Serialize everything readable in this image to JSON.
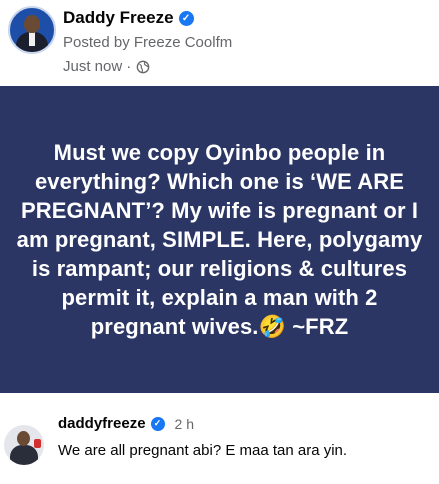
{
  "post": {
    "author_name": "Daddy Freeze",
    "posted_by": "Posted by Freeze Coolfm",
    "time": "Just now",
    "separator": "·",
    "privacy_icon": "globe-icon"
  },
  "banner": {
    "text": "Must we copy Oyinbo people in everything? Which one is ‘WE ARE PREGNANT’? My wife is pregnant or I am pregnant, SIMPLE. Here, polygamy is rampant; our religions & cultures permit it, explain a man with 2 pregnant wives.🤣 ~FRZ",
    "background": "#2b3665",
    "text_color": "#ffffff"
  },
  "comment": {
    "username": "daddyfreeze",
    "time": "2 h",
    "text": "We are all pregnant abi? E maa tan ara yin."
  },
  "colors": {
    "verified": "#1877f2",
    "secondary_text": "#65676b"
  }
}
